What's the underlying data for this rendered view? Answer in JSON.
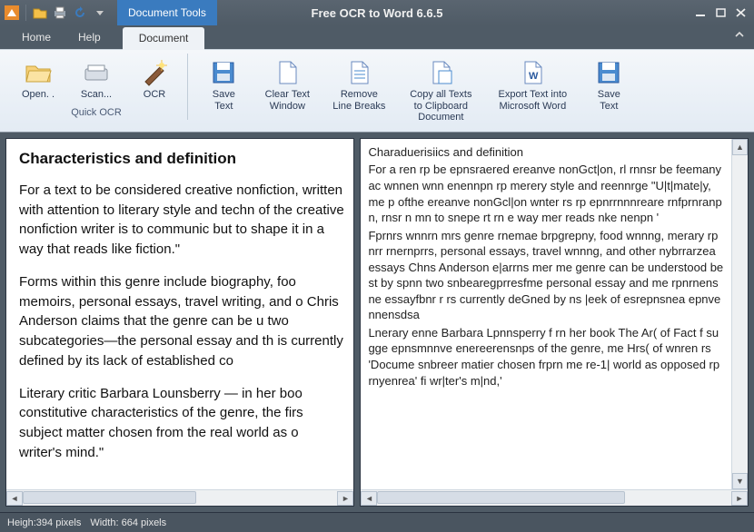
{
  "app": {
    "title": "Free OCR to Word 6.6.5",
    "contextual_tab_group": "Document Tools"
  },
  "menu": {
    "home": "Home",
    "help": "Help",
    "document": "Document"
  },
  "ribbon": {
    "group_quick_ocr": "Quick OCR",
    "open": "Open. .",
    "scan": "Scan...",
    "ocr": "OCR",
    "save_text": "Save\nText",
    "clear_text_window": "Clear Text\nWindow",
    "remove_line_breaks": "Remove\nLine Breaks",
    "copy_all_texts": "Copy all Texts\nto Clipboard\nDocument",
    "export_word": "Export Text into\nMicrosoft Word",
    "save_text2": "Save\nText"
  },
  "left_doc": {
    "heading": "Characteristics and definition",
    "p1": "For a text to be considered creative nonfiction, written with attention to literary style and techn of the creative nonfiction writer is to communic but to shape it in a way that reads like fiction.\"",
    "p2": "Forms within this genre include biography, foo memoirs, personal essays, travel writing, and o Chris Anderson claims that the genre can be u two subcategories—the personal essay and th is currently defined by its lack of established co",
    "p3": "Literary critic Barbara Lounsberry — in her boo constitutive characteristics of the genre, the firs subject matter chosen from the real world as o writer's mind.\""
  },
  "right_ocr": {
    "heading": "Charaduerisiics and definition",
    "p1": "For a ren rp be epnsraered ereanve nonGct|on, rl rnnsr be feemany ac wnnen wnn enennpn rp merery style and reennrge \"U|t|mate|y, me p ofthe ereanve nonGcl|on wnter rs rp epnrrnnnreare rnfprnranpn, rnsr n mn to snepe rt rn e way mer reads nke nenpn '",
    "p2": "Fprnrs wnnrn mrs genre rnemae brpgrepny, food wnnng, merary rpnrr rnernprrs, personal essays, travel wnnng, and other nybrrarzea essays Chns Anderson e|arrns mer me genre can be understood best by spnn two snbearegprresfme personal essay and me rpnrnensne essayfbnr r rs currently deGned by ns |eek of esrepnsnea epnvennensdsa",
    "p3": "Lnerary enne Barbara Lpnnsperry f rn her book The Ar( of Fact f sugge epnsmnnve enereerensnps of the genre, me Hrs( of wnren rs 'Docume snbreer matier chosen frprn me re-1| world as opposed rp rnyenrea' fi wr|ter's m|nd,'"
  },
  "status": {
    "height_label": "Heigh:",
    "height_value": "394 pixels",
    "width_label": "Width:",
    "width_value": "664 pixels"
  }
}
